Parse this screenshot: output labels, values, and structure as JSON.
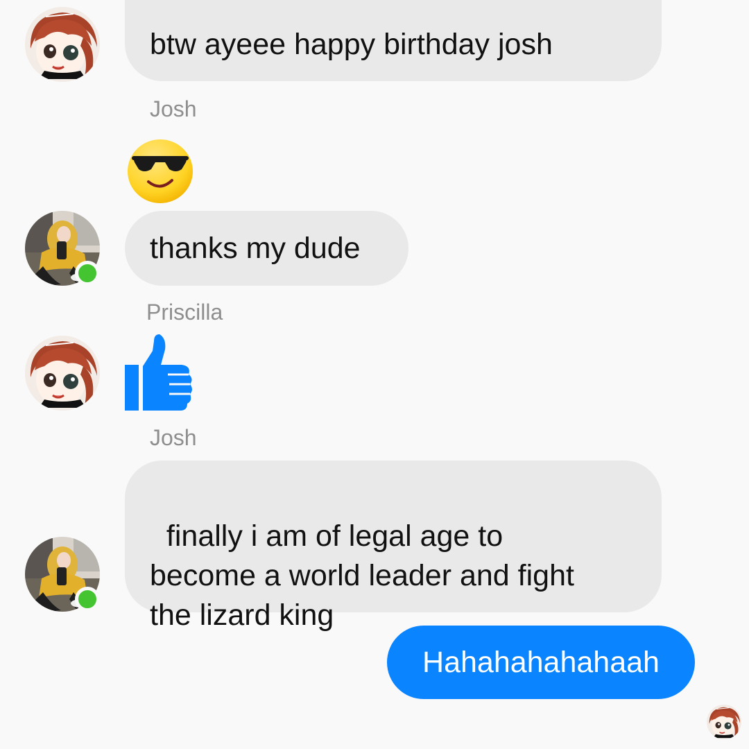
{
  "messages": [
    {
      "id": "m1",
      "sender": "Priscilla",
      "text": "btw ayeee happy birthday josh"
    },
    {
      "id": "m2",
      "sender": "Josh",
      "sticker": "sunglasses-smiley-emoji"
    },
    {
      "id": "m3",
      "sender": "Josh",
      "text": "thanks my dude"
    },
    {
      "id": "m4",
      "sender": "Priscilla",
      "sticker": "thumbs-up-like"
    },
    {
      "id": "m5",
      "sender": "Josh",
      "text": "finally i am of legal age to\nbecome a world leader and fight\nthe lizard king"
    },
    {
      "id": "m6",
      "sender": "me",
      "text": "Hahahahahahaah"
    }
  ],
  "sender_labels": {
    "josh_1": "Josh",
    "priscilla": "Priscilla",
    "josh_2": "Josh"
  },
  "participants": {
    "josh": {
      "online": true,
      "avatar": "photo-avatar"
    },
    "priscilla": {
      "online": false,
      "avatar": "anime-avatar"
    }
  },
  "colors": {
    "incoming_bubble": "#e9e9e9",
    "outgoing_bubble": "#0a84ff",
    "online_dot": "#45c432",
    "like_blue": "#0a84ff",
    "background": "#f9f9f9"
  }
}
